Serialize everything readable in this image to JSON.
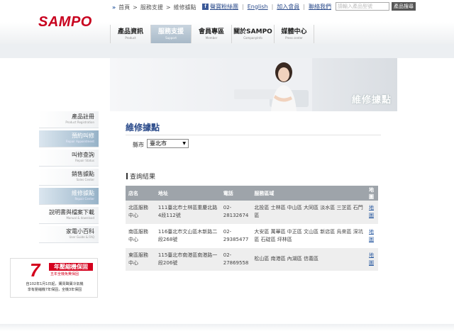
{
  "header": {
    "logo": "SAMPO",
    "util": {
      "facebook": "f",
      "fan_page": "聲寶粉絲團",
      "english": "English",
      "join_member": "加入會員",
      "contact_us": "聯絡我們",
      "search_placeholder": "請輸入產品型號",
      "search_button": "產品搜尋"
    },
    "nav": [
      {
        "label": "產品資訊",
        "en": "Product"
      },
      {
        "label": "服務支援",
        "en": "Support"
      },
      {
        "label": "會員專區",
        "en": "Member"
      },
      {
        "label": "關於SAMPO",
        "en": "CompanyInfo"
      },
      {
        "label": "媒體中心",
        "en": "Press center"
      }
    ]
  },
  "breadcrumb": {
    "home": "首頁",
    "sep1": ">",
    "section": "服務支援",
    "sep2": ">",
    "current": "維修據點"
  },
  "banner": {
    "title": "維修據點"
  },
  "sidebar": [
    {
      "label": "產品註冊",
      "en": "Product Registration"
    },
    {
      "label": "預約叫修",
      "en": "Repair Appointment"
    },
    {
      "label": "叫修查詢",
      "en": "Repair Status"
    },
    {
      "label": "銷售據點",
      "en": "Sales Center"
    },
    {
      "label": "維修據點",
      "en": "Repair Center"
    },
    {
      "label": "說明書與檔案下載",
      "en": "Manual & download"
    },
    {
      "label": "家電小百科",
      "en": "User Guide & FAQ"
    }
  ],
  "promo": {
    "number": "7",
    "title": "年壓縮機保固",
    "subtitle": "五年全機免費保固",
    "line1": "自102年1月1日起，購買聲寶冷氣機",
    "line2": "享有壓縮機7年保固，全機3年保固"
  },
  "main": {
    "page_title": "維修據點",
    "county_label": "縣市",
    "county_value": "臺北市",
    "result_title": "查詢結果",
    "table": {
      "headers": [
        "店名",
        "地址",
        "電話",
        "服務區域",
        "地圖"
      ],
      "rows": [
        {
          "name": "北區服務中心",
          "address": "111臺北市士林區重慶北路4段112號",
          "phone": "02-28132674",
          "area": "北投區 士林區 中山區 大同區 淡水區 三芝區 石門區",
          "map": "地圖"
        },
        {
          "name": "南區服務中心",
          "address": "116臺北市文山區木新路二段268號",
          "phone": "02-29385477",
          "area": "大安區 萬華區 中正區 文山區 新店區 烏來區 深坑區 石碇區 坪林區",
          "map": "地圖"
        },
        {
          "name": "東區服務中心",
          "address": "115臺北市南港區南港路一段206號",
          "phone": "02-27869558",
          "area": "松山區 南港區 內湖區 信義區",
          "map": "地圖"
        }
      ]
    }
  },
  "colors": {
    "brand": "#c8001e",
    "link": "#2a5aa0",
    "table_header": "#9ea4aa",
    "active_nav": "#a8b9c8"
  }
}
